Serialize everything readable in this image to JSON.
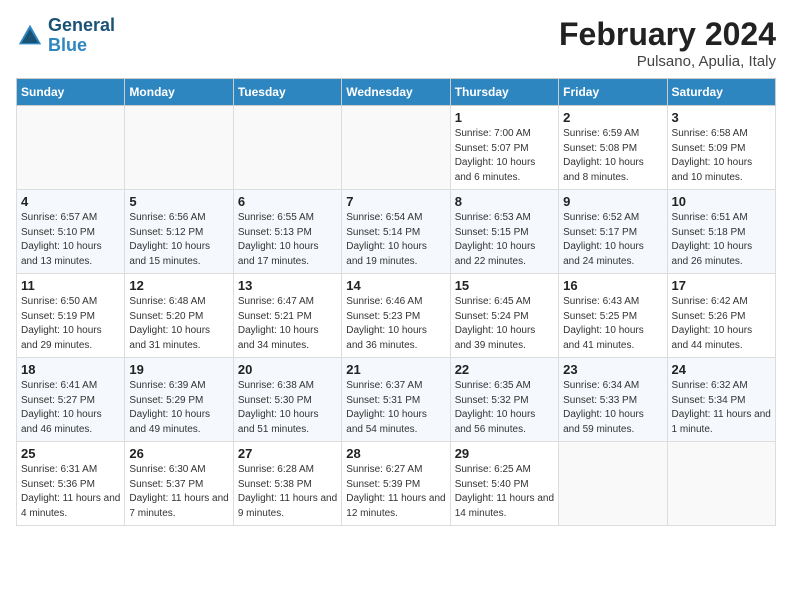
{
  "header": {
    "logo_line1": "General",
    "logo_line2": "Blue",
    "month_year": "February 2024",
    "location": "Pulsano, Apulia, Italy"
  },
  "weekdays": [
    "Sunday",
    "Monday",
    "Tuesday",
    "Wednesday",
    "Thursday",
    "Friday",
    "Saturday"
  ],
  "weeks": [
    [
      {
        "day": "",
        "sunrise": "",
        "sunset": "",
        "daylight": ""
      },
      {
        "day": "",
        "sunrise": "",
        "sunset": "",
        "daylight": ""
      },
      {
        "day": "",
        "sunrise": "",
        "sunset": "",
        "daylight": ""
      },
      {
        "day": "",
        "sunrise": "",
        "sunset": "",
        "daylight": ""
      },
      {
        "day": "1",
        "sunrise": "Sunrise: 7:00 AM",
        "sunset": "Sunset: 5:07 PM",
        "daylight": "Daylight: 10 hours and 6 minutes."
      },
      {
        "day": "2",
        "sunrise": "Sunrise: 6:59 AM",
        "sunset": "Sunset: 5:08 PM",
        "daylight": "Daylight: 10 hours and 8 minutes."
      },
      {
        "day": "3",
        "sunrise": "Sunrise: 6:58 AM",
        "sunset": "Sunset: 5:09 PM",
        "daylight": "Daylight: 10 hours and 10 minutes."
      }
    ],
    [
      {
        "day": "4",
        "sunrise": "Sunrise: 6:57 AM",
        "sunset": "Sunset: 5:10 PM",
        "daylight": "Daylight: 10 hours and 13 minutes."
      },
      {
        "day": "5",
        "sunrise": "Sunrise: 6:56 AM",
        "sunset": "Sunset: 5:12 PM",
        "daylight": "Daylight: 10 hours and 15 minutes."
      },
      {
        "day": "6",
        "sunrise": "Sunrise: 6:55 AM",
        "sunset": "Sunset: 5:13 PM",
        "daylight": "Daylight: 10 hours and 17 minutes."
      },
      {
        "day": "7",
        "sunrise": "Sunrise: 6:54 AM",
        "sunset": "Sunset: 5:14 PM",
        "daylight": "Daylight: 10 hours and 19 minutes."
      },
      {
        "day": "8",
        "sunrise": "Sunrise: 6:53 AM",
        "sunset": "Sunset: 5:15 PM",
        "daylight": "Daylight: 10 hours and 22 minutes."
      },
      {
        "day": "9",
        "sunrise": "Sunrise: 6:52 AM",
        "sunset": "Sunset: 5:17 PM",
        "daylight": "Daylight: 10 hours and 24 minutes."
      },
      {
        "day": "10",
        "sunrise": "Sunrise: 6:51 AM",
        "sunset": "Sunset: 5:18 PM",
        "daylight": "Daylight: 10 hours and 26 minutes."
      }
    ],
    [
      {
        "day": "11",
        "sunrise": "Sunrise: 6:50 AM",
        "sunset": "Sunset: 5:19 PM",
        "daylight": "Daylight: 10 hours and 29 minutes."
      },
      {
        "day": "12",
        "sunrise": "Sunrise: 6:48 AM",
        "sunset": "Sunset: 5:20 PM",
        "daylight": "Daylight: 10 hours and 31 minutes."
      },
      {
        "day": "13",
        "sunrise": "Sunrise: 6:47 AM",
        "sunset": "Sunset: 5:21 PM",
        "daylight": "Daylight: 10 hours and 34 minutes."
      },
      {
        "day": "14",
        "sunrise": "Sunrise: 6:46 AM",
        "sunset": "Sunset: 5:23 PM",
        "daylight": "Daylight: 10 hours and 36 minutes."
      },
      {
        "day": "15",
        "sunrise": "Sunrise: 6:45 AM",
        "sunset": "Sunset: 5:24 PM",
        "daylight": "Daylight: 10 hours and 39 minutes."
      },
      {
        "day": "16",
        "sunrise": "Sunrise: 6:43 AM",
        "sunset": "Sunset: 5:25 PM",
        "daylight": "Daylight: 10 hours and 41 minutes."
      },
      {
        "day": "17",
        "sunrise": "Sunrise: 6:42 AM",
        "sunset": "Sunset: 5:26 PM",
        "daylight": "Daylight: 10 hours and 44 minutes."
      }
    ],
    [
      {
        "day": "18",
        "sunrise": "Sunrise: 6:41 AM",
        "sunset": "Sunset: 5:27 PM",
        "daylight": "Daylight: 10 hours and 46 minutes."
      },
      {
        "day": "19",
        "sunrise": "Sunrise: 6:39 AM",
        "sunset": "Sunset: 5:29 PM",
        "daylight": "Daylight: 10 hours and 49 minutes."
      },
      {
        "day": "20",
        "sunrise": "Sunrise: 6:38 AM",
        "sunset": "Sunset: 5:30 PM",
        "daylight": "Daylight: 10 hours and 51 minutes."
      },
      {
        "day": "21",
        "sunrise": "Sunrise: 6:37 AM",
        "sunset": "Sunset: 5:31 PM",
        "daylight": "Daylight: 10 hours and 54 minutes."
      },
      {
        "day": "22",
        "sunrise": "Sunrise: 6:35 AM",
        "sunset": "Sunset: 5:32 PM",
        "daylight": "Daylight: 10 hours and 56 minutes."
      },
      {
        "day": "23",
        "sunrise": "Sunrise: 6:34 AM",
        "sunset": "Sunset: 5:33 PM",
        "daylight": "Daylight: 10 hours and 59 minutes."
      },
      {
        "day": "24",
        "sunrise": "Sunrise: 6:32 AM",
        "sunset": "Sunset: 5:34 PM",
        "daylight": "Daylight: 11 hours and 1 minute."
      }
    ],
    [
      {
        "day": "25",
        "sunrise": "Sunrise: 6:31 AM",
        "sunset": "Sunset: 5:36 PM",
        "daylight": "Daylight: 11 hours and 4 minutes."
      },
      {
        "day": "26",
        "sunrise": "Sunrise: 6:30 AM",
        "sunset": "Sunset: 5:37 PM",
        "daylight": "Daylight: 11 hours and 7 minutes."
      },
      {
        "day": "27",
        "sunrise": "Sunrise: 6:28 AM",
        "sunset": "Sunset: 5:38 PM",
        "daylight": "Daylight: 11 hours and 9 minutes."
      },
      {
        "day": "28",
        "sunrise": "Sunrise: 6:27 AM",
        "sunset": "Sunset: 5:39 PM",
        "daylight": "Daylight: 11 hours and 12 minutes."
      },
      {
        "day": "29",
        "sunrise": "Sunrise: 6:25 AM",
        "sunset": "Sunset: 5:40 PM",
        "daylight": "Daylight: 11 hours and 14 minutes."
      },
      {
        "day": "",
        "sunrise": "",
        "sunset": "",
        "daylight": ""
      },
      {
        "day": "",
        "sunrise": "",
        "sunset": "",
        "daylight": ""
      }
    ]
  ]
}
